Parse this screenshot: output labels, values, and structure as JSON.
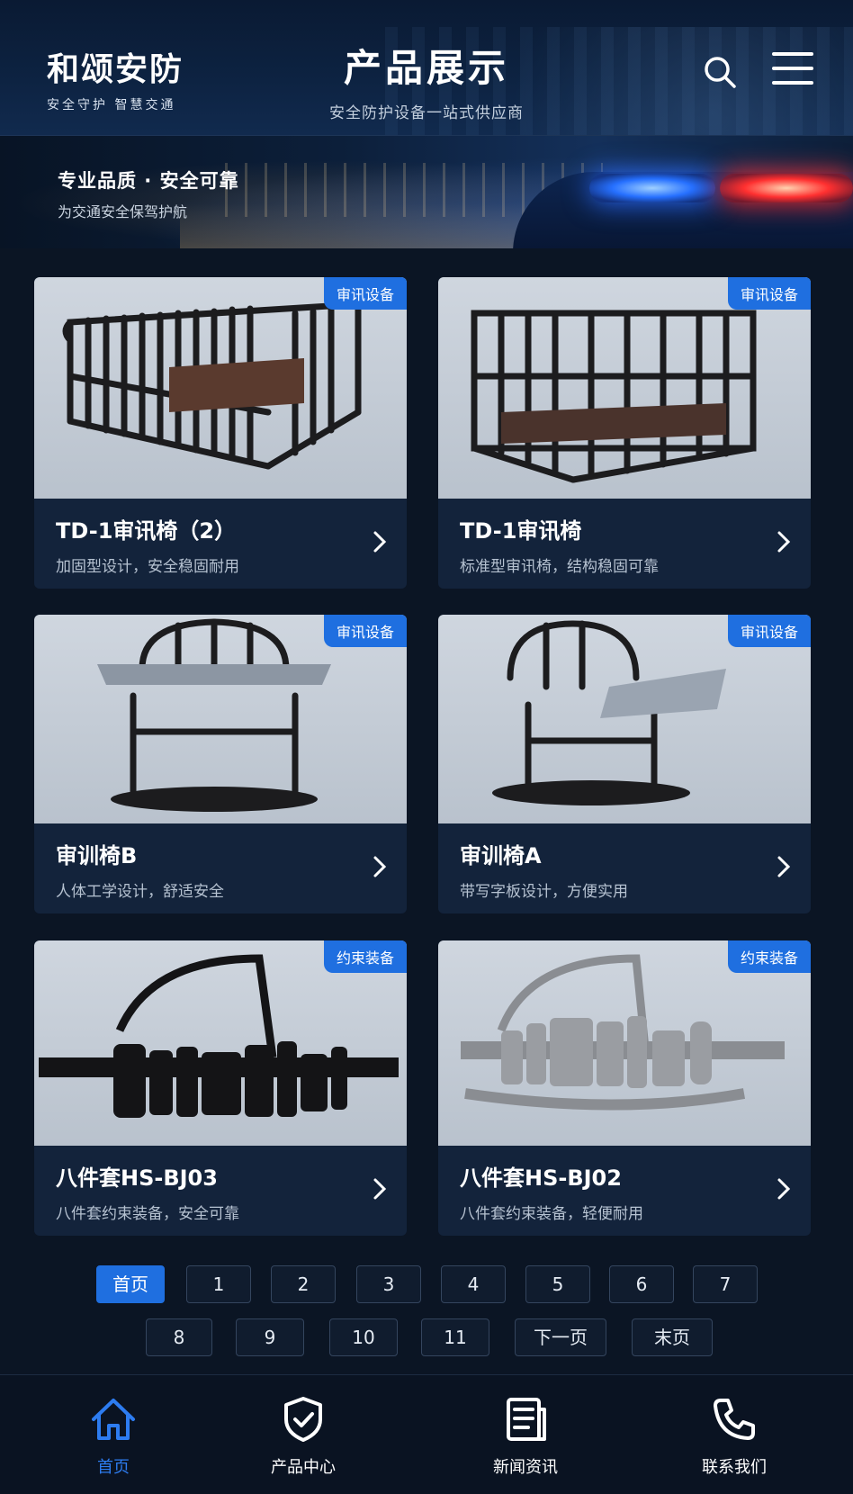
{
  "header": {
    "logo_title": "和颂安防",
    "logo_subtitle": "安全守护  智慧交通",
    "title": "产品展示",
    "subtitle": "安全防护设备一站式供应商",
    "icons": {
      "search": "search-icon",
      "menu": "menu-icon"
    }
  },
  "banner": {
    "title": "专业品质 · 安全可靠",
    "subtitle": "为交通安全保驾护航"
  },
  "products": [
    {
      "tag": "审讯设备",
      "name": "TD-1审讯椅（2）",
      "desc": "加固型设计，安全稳固耐用"
    },
    {
      "tag": "审讯设备",
      "name": "TD-1审讯椅",
      "desc": "标准型审讯椅，结构稳固可靠"
    },
    {
      "tag": "审讯设备",
      "name": "审训椅B",
      "desc": "人体工学设计，舒适安全"
    },
    {
      "tag": "审讯设备",
      "name": "审训椅A",
      "desc": "带写字板设计，方便实用"
    },
    {
      "tag": "约束装备",
      "name": "八件套HS-BJ03",
      "desc": "八件套约束装备，安全可靠"
    },
    {
      "tag": "约束装备",
      "name": "八件套HS-BJ02",
      "desc": "八件套约束装备，轻便耐用"
    }
  ],
  "pagination": {
    "first": "首页",
    "pages": [
      "1",
      "2",
      "3",
      "4",
      "5",
      "6",
      "7",
      "8",
      "9",
      "10",
      "11"
    ],
    "next": "下一页",
    "last": "末页",
    "active": "首页"
  },
  "bottom_nav": [
    {
      "label": "首页",
      "icon": "home-icon",
      "active": true
    },
    {
      "label": "产品中心",
      "icon": "shield-check-icon",
      "active": false
    },
    {
      "label": "新闻资讯",
      "icon": "news-icon",
      "active": false
    },
    {
      "label": "联系我们",
      "icon": "phone-icon",
      "active": false
    }
  ],
  "colors": {
    "accent": "#1f6fe0",
    "background": "#0b1524",
    "card": "#13233b"
  }
}
